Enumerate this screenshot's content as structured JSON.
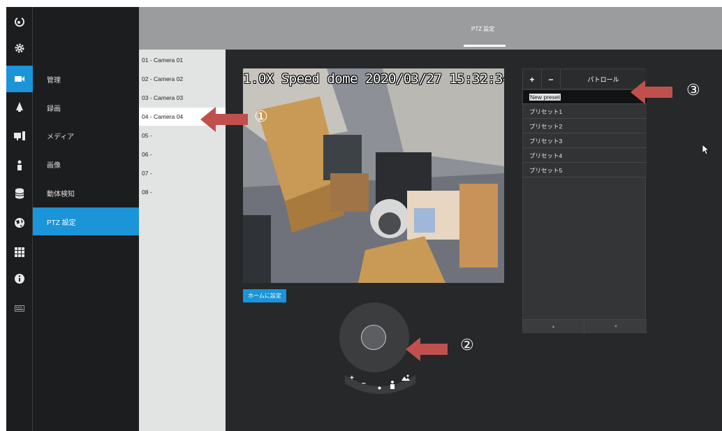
{
  "header": {
    "tab_label": "PTZ 設定"
  },
  "rail": {
    "icons": [
      "logout-icon",
      "gear-icon",
      "camera-icon",
      "bell-icon",
      "monitor-icon",
      "person-icon",
      "database-icon",
      "globe-icon",
      "grid-icon",
      "info-icon",
      "keyboard-icon"
    ],
    "active_index": 2
  },
  "menu": {
    "items": [
      {
        "label": "管理"
      },
      {
        "label": "録画"
      },
      {
        "label": "メディア"
      },
      {
        "label": "画像"
      },
      {
        "label": "動体検知"
      },
      {
        "label": "PTZ 設定"
      }
    ],
    "active_index": 5
  },
  "cameras": {
    "items": [
      {
        "label": "01 - Camera 01"
      },
      {
        "label": "02 - Camera 02"
      },
      {
        "label": "03 - Camera 03"
      },
      {
        "label": "04 - Camera 04"
      },
      {
        "label": "05 -"
      },
      {
        "label": "06 -"
      },
      {
        "label": "07 -"
      },
      {
        "label": "08 -"
      }
    ],
    "selected_index": 3
  },
  "video": {
    "osd_text": "1.0X Speed dome 2020/03/27 15:32:34"
  },
  "controls": {
    "home_button": "ホームに設定",
    "zoom_in": "+",
    "zoom_out": "−"
  },
  "preset_panel": {
    "add_label": "+",
    "remove_label": "−",
    "title": "パトロール",
    "editing_value": "New preset",
    "presets": [
      {
        "label": "プリセット1"
      },
      {
        "label": "プリセット2"
      },
      {
        "label": "プリセット3"
      },
      {
        "label": "プリセット4"
      },
      {
        "label": "プリセット5"
      }
    ],
    "up_label": "▲",
    "down_label": "▼"
  },
  "annotations": {
    "callout_1": "①",
    "callout_2": "②",
    "callout_3": "③",
    "arrow_color": "#c0504d"
  },
  "colors": {
    "accent": "#1b94d8",
    "header": "#9a9c9e",
    "background": "#26282a"
  }
}
